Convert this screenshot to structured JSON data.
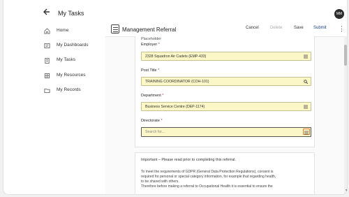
{
  "header": {
    "back_icon": "arrow-left-icon",
    "title": "My Tasks",
    "avatar_initials": "MM"
  },
  "sidebar": {
    "items": [
      {
        "label": "Home",
        "icon": "home-icon"
      },
      {
        "label": "My Dashboards",
        "icon": "dashboard-icon"
      },
      {
        "label": "My Tasks",
        "icon": "clipboard-icon"
      },
      {
        "label": "My Resources",
        "icon": "resources-icon"
      },
      {
        "label": "My Records",
        "icon": "folder-icon"
      }
    ]
  },
  "form": {
    "title": "Management Referral",
    "actions": {
      "cancel": "Cancel",
      "delete": "Delete",
      "save": "Save",
      "submit": "Submit"
    },
    "placeholder_label": "Placeholder",
    "fields": [
      {
        "label": "Employer",
        "required": "*",
        "value": "2328 Squadron Air Cadets (EMP-433)",
        "icon": "list-icon"
      },
      {
        "label": "Post Title",
        "required": "*",
        "value": "TRAINING COORDINATOR (COH-101)",
        "icon": "search-icon"
      },
      {
        "label": "Department",
        "required": "*",
        "value": "Business Service Centre (DEP-1174)",
        "icon": "list-icon"
      },
      {
        "label": "Directorate",
        "required": "*",
        "value": "",
        "placeholder": "Search for...",
        "icon": "list-icon"
      }
    ]
  },
  "notice": {
    "heading": "Important – Please read prior to completing this referral.",
    "lines": [
      "To meet the requirements of GDPR (General Data Protection Regulations), consent is",
      "required for personal or special category information, for example that regarding health,",
      "to be shared with others.",
      "Therefore before making a referral to Occupational Health it is essential to ensure the"
    ]
  },
  "colors": {
    "field_bg": "#fbf7c6",
    "primary": "#1a3f8b",
    "focus_ring": "#e07b39"
  }
}
